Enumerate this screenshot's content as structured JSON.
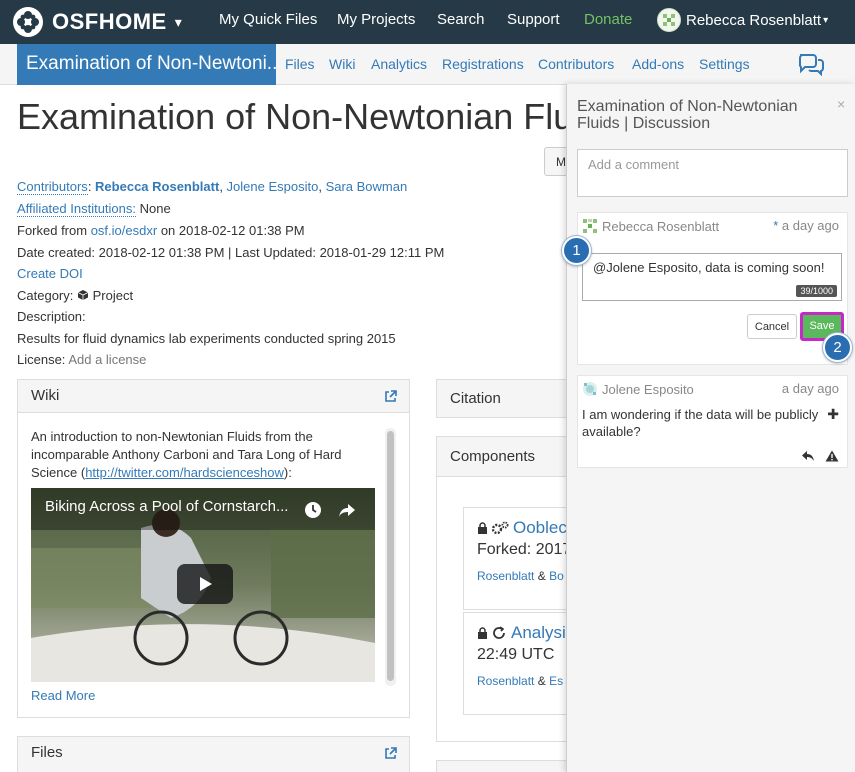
{
  "topnav": {
    "brand": "OSFHOME",
    "brand_caret": "▾",
    "links": [
      "My Quick Files",
      "My Projects",
      "Search",
      "Support",
      "Donate"
    ],
    "user_name": "Rebecca Rosenblatt",
    "user_caret": "▾"
  },
  "subnav": {
    "project_title": "Examination of Non-Newtoni...",
    "links": [
      "Files",
      "Wiki",
      "Analytics",
      "Registrations",
      "Contributors",
      "Add-ons",
      "Settings"
    ]
  },
  "project": {
    "title": "Examination of Non-Newtonian Fluids",
    "make_button": "M",
    "contributors_label": "Contributors",
    "contributor_1": "Rebecca Rosenblatt",
    "contributor_2": "Jolene Esposito",
    "contributor_3": "Sara Bowman",
    "affiliated_label": "Affiliated Institutions:",
    "affiliated_value": "None",
    "forked_prefix": "Forked from",
    "forked_link": "osf.io/esdxr",
    "forked_suffix": "on 2018-02-12 01:38 PM",
    "dates": "Date created: 2018-02-12 01:38 PM | Last Updated: 2018-01-29 12:11 PM",
    "create_doi": "Create DOI",
    "category_label": "Category:",
    "category_value": "Project",
    "description_label": "Description:",
    "description": "Results for fluid dynamics lab experiments conducted spring 2015",
    "license_label": "License:",
    "license_value": "Add a license"
  },
  "wiki": {
    "heading": "Wiki",
    "text_1": "An introduction to non-Newtonian Fluids from the incomparable Anthony Carboni and Tara Long of Hard Science (",
    "text_link": "http://twitter.com/hardscienceshow",
    "text_2": "):",
    "video_title": "Biking Across a Pool of Cornstarch...",
    "read_more": "Read More"
  },
  "files": {
    "heading": "Files"
  },
  "citation": {
    "heading": "Citation"
  },
  "components": {
    "heading": "Components",
    "items": [
      {
        "title": "Oobleck",
        "line": "Forked: 2017",
        "author_1": "Rosenblatt",
        "amp": "&",
        "author_2": "Bo"
      },
      {
        "title": "Analysis",
        "line": "22:49 UTC",
        "author_1": "Rosenblatt",
        "amp": "&",
        "author_2": "Es"
      }
    ]
  },
  "discussion": {
    "title": "Examination of Non-Newtonian Fluids | Discussion",
    "close": "×",
    "add_comment_placeholder": "Add a comment",
    "comments": [
      {
        "author": "Rebecca Rosenblatt",
        "star": "*",
        "ago": "a day ago",
        "edit_value": "@Jolene Esposito, data is coming soon!",
        "counter": "39/1000",
        "cancel": "Cancel",
        "save": "Save"
      },
      {
        "author": "Jolene Esposito",
        "ago": "a day ago",
        "body": "I am wondering if the data will be publicly available?",
        "plus": "✚"
      }
    ]
  },
  "steps": [
    "1",
    "2"
  ],
  "colors": {
    "navbar": "#263947",
    "link": "#337ab7",
    "donate": "#74c266",
    "save": "#5cb85c",
    "highlight": "#c627c6",
    "step_badge": "#2b6db1"
  }
}
